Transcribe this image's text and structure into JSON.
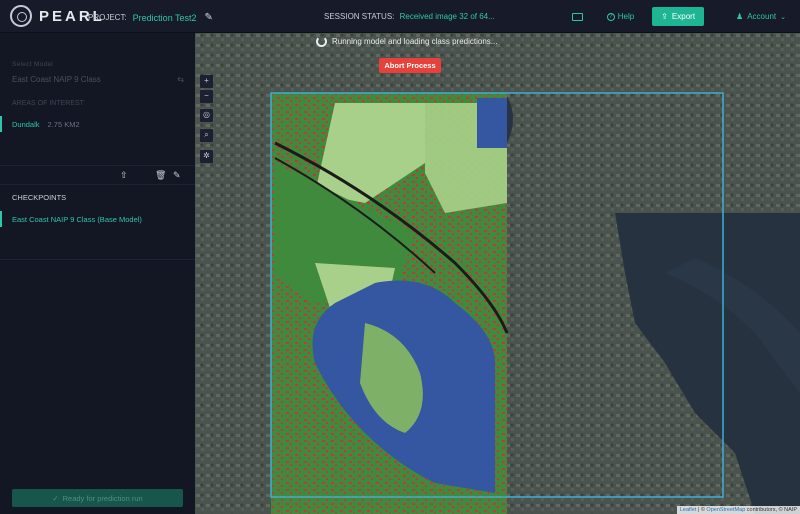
{
  "header": {
    "logo_text": "PEARL",
    "project_label": "PROJECT:",
    "project_name": "Prediction Test2",
    "session_label": "SESSION STATUS:",
    "session_value": "Received image 32 of 64...",
    "help_label": "Help",
    "export_label": "Export",
    "account_label": "Account"
  },
  "sidebar": {
    "model_section_label": "Select Model",
    "model_name": "East Coast NAIP 9 Class",
    "aoi_section_label": "AREAS OF INTEREST",
    "aoi": {
      "name": "Dundalk",
      "size": "2.75 KM2"
    },
    "checkpoints_label": "CHECKPOINTS",
    "checkpoint": "East Coast NAIP 9 Class (Base Model)",
    "ready_button": "Ready for prediction run"
  },
  "status": {
    "message": "Running model and loading class predictions...",
    "abort_label": "Abort Process"
  },
  "map_controls": {
    "zoom_in": "+",
    "zoom_out": "−"
  },
  "attribution": {
    "leaflet": "Leaflet",
    "separator": " | © ",
    "osm": "OpenStreetMap",
    "rest": " contributors, © NAIP"
  },
  "colors": {
    "accent": "#2fc5a8",
    "abort": "#e8403a",
    "water_class": "#3556a0",
    "tree_class": "#3f8a3c",
    "grass_class": "#a9d08a",
    "building_class": "#c03a3a"
  }
}
